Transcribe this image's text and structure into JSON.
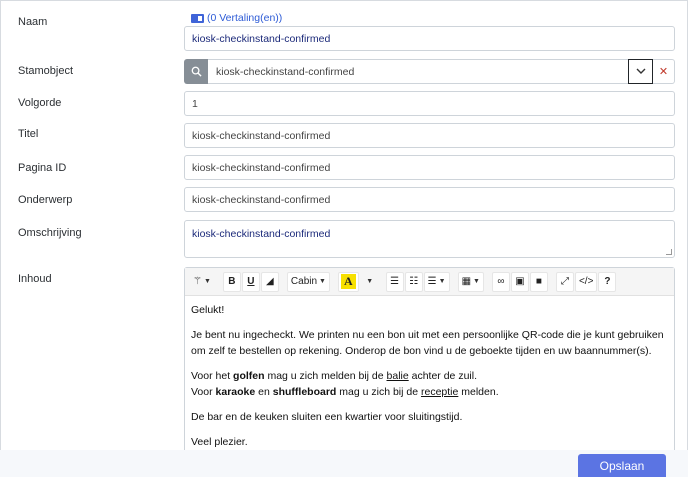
{
  "form": {
    "naam": {
      "label": "Naam",
      "translations_link": "(0 Vertaling(en))",
      "value": "kiosk-checkinstand-confirmed"
    },
    "stamobject": {
      "label": "Stamobject",
      "value": "kiosk-checkinstand-confirmed"
    },
    "volgorde": {
      "label": "Volgorde",
      "value": "1"
    },
    "titel": {
      "label": "Titel",
      "value": "kiosk-checkinstand-confirmed"
    },
    "pagina_id": {
      "label": "Pagina ID",
      "value": "kiosk-checkinstand-confirmed"
    },
    "onderwerp": {
      "label": "Onderwerp",
      "value": "kiosk-checkinstand-confirmed"
    },
    "omschrijving": {
      "label": "Omschrijving",
      "value": "kiosk-checkinstand-confirmed"
    },
    "inhoud": {
      "label": "Inhoud"
    }
  },
  "editor": {
    "toolbar": {
      "font_name": "Cabin",
      "buttons": [
        "magic-wand",
        "bold",
        "underline",
        "eraser",
        "font",
        "text-color",
        "unordered-list",
        "ordered-list",
        "align",
        "table",
        "link",
        "image",
        "video",
        "fullscreen",
        "code-view",
        "help"
      ]
    },
    "content": {
      "p1": "Gelukt!",
      "p2": "Je bent nu ingecheckt. We printen nu een bon uit met een persoonlijke QR-code die je kunt gebruiken om zelf te bestellen op rekening. Onderop de bon vind u de geboekte tijden en uw baannummer(s).",
      "p3_a": "Voor het ",
      "p3_golfen": "golfen",
      "p3_b": " mag u zich melden bij de ",
      "p3_balie": "balie",
      "p3_c": " achter de zuil.",
      "p3_d": "Voor ",
      "p3_karaoke": "karaoke",
      "p3_e": " en ",
      "p3_shuffleboard": "shuffleboard",
      "p3_f": " mag u zich bij de ",
      "p3_receptie": "receptie",
      "p3_g": " melden.",
      "p4": "De bar en de keuken sluiten een kwartier voor sluitingstijd.",
      "p5": "Veel plezier."
    }
  },
  "actions": {
    "save_label": "Opslaan"
  },
  "colors": {
    "accent": "#5b74e3",
    "link": "#2d5bd6",
    "search_bg": "#868e96"
  }
}
